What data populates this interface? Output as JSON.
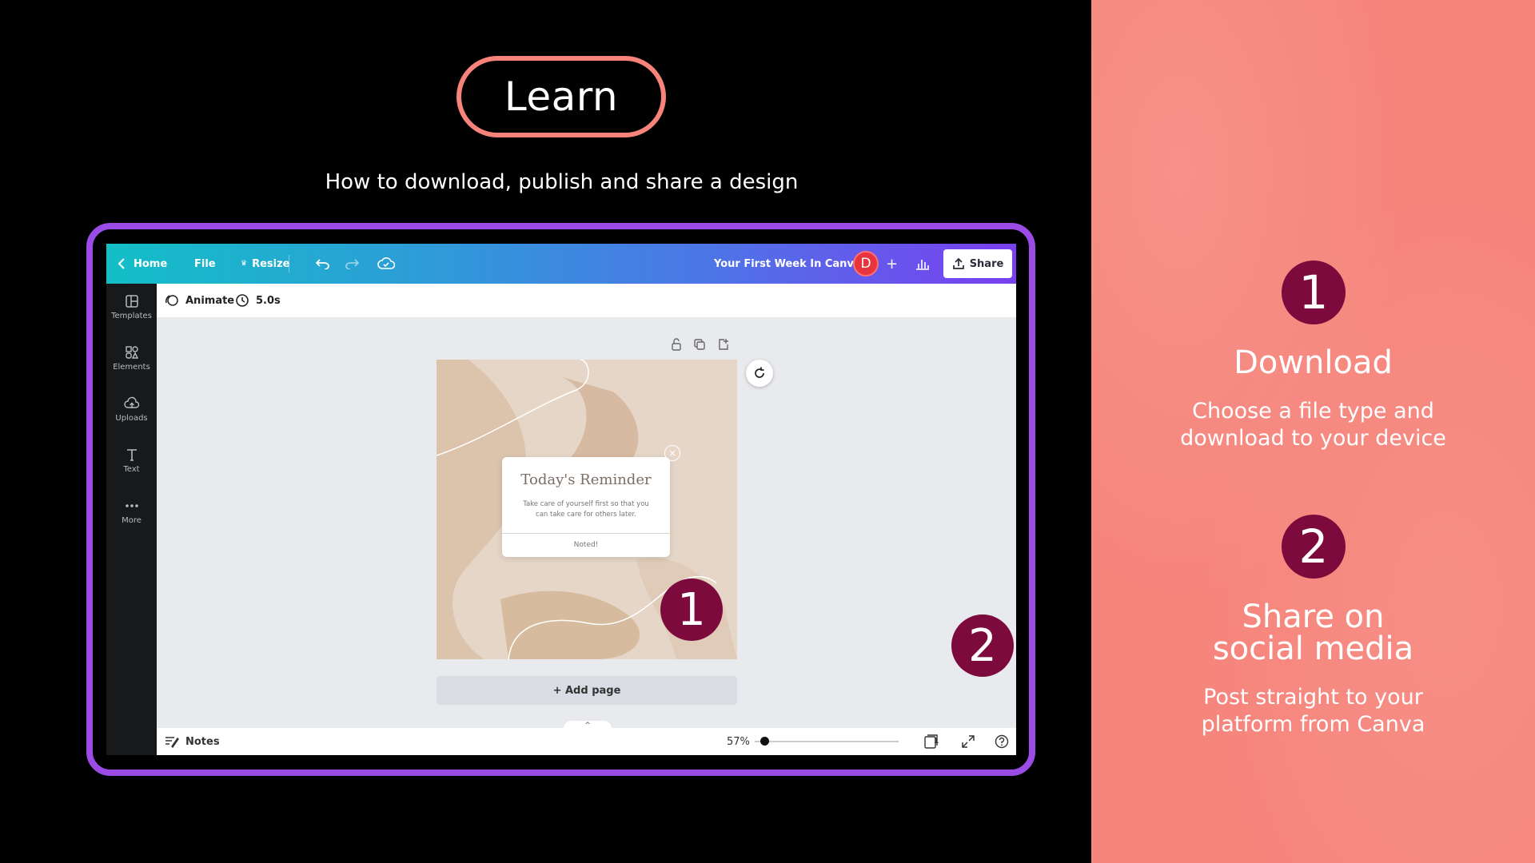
{
  "header": {
    "badge_label": "Learn",
    "subtitle": "How to download, publish and share a design"
  },
  "canva": {
    "topbar": {
      "home": "Home",
      "file": "File",
      "resize": "Resize",
      "doc_title": "Your First Week In Canva",
      "avatar_initial": "D",
      "share": "Share"
    },
    "sidebar": {
      "items": [
        {
          "label": "Templates",
          "icon": "templates-icon"
        },
        {
          "label": "Elements",
          "icon": "elements-icon"
        },
        {
          "label": "Uploads",
          "icon": "uploads-icon"
        },
        {
          "label": "Text",
          "icon": "text-icon"
        },
        {
          "label": "More",
          "icon": "more-icon"
        }
      ]
    },
    "subbar": {
      "animate": "Animate",
      "duration": "5.0s"
    },
    "design": {
      "card_title": "Today's Reminder",
      "card_body": "Take care of yourself first so that you can take care for others later.",
      "card_button": "Noted!"
    },
    "add_page": "+ Add page",
    "bottombar": {
      "notes": "Notes",
      "zoom": "57%",
      "page_count": "1"
    },
    "markers": [
      "1",
      "2"
    ]
  },
  "steps": [
    {
      "number": "1",
      "title": "Download",
      "description_line1": "Choose a file type and",
      "description_line2": "download to your device"
    },
    {
      "number": "2",
      "title_line1": "Share on",
      "title_line2": "social media",
      "description_line1": "Post straight to your",
      "description_line2": "platform from Canva"
    }
  ],
  "colors": {
    "accent_coral": "#f6857c",
    "badge_maroon": "#7c0a3d",
    "frame_purple": "#9b4ce6"
  }
}
